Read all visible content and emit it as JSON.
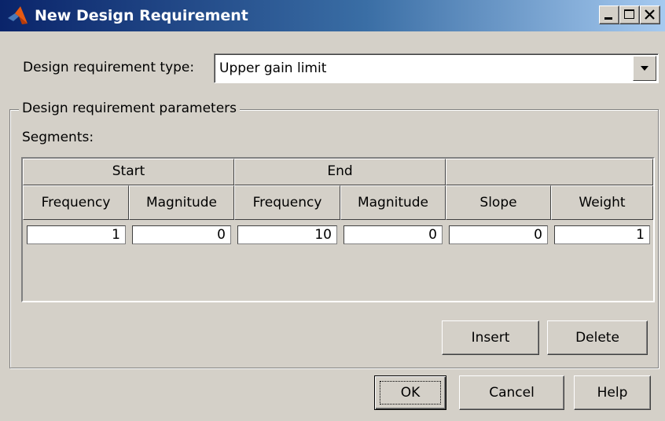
{
  "window": {
    "title": "New Design Requirement",
    "icon": "matlab-logo-icon",
    "controls": {
      "minimize": "minimize-icon",
      "maximize": "maximize-icon",
      "close": "close-icon"
    }
  },
  "requirement_type": {
    "label": "Design requirement type:",
    "value": "Upper gain limit"
  },
  "parameters": {
    "group_title": "Design requirement parameters",
    "segments_label": "Segments:",
    "table": {
      "group_headers": [
        "Start",
        "End",
        ""
      ],
      "columns": [
        "Frequency",
        "Magnitude",
        "Frequency",
        "Magnitude",
        "Slope",
        "Weight"
      ],
      "rows": [
        [
          "1",
          "0",
          "10",
          "0",
          "0",
          "1"
        ]
      ]
    },
    "buttons": {
      "insert": "Insert",
      "delete": "Delete"
    }
  },
  "footer": {
    "ok": "OK",
    "cancel": "Cancel",
    "help": "Help"
  }
}
